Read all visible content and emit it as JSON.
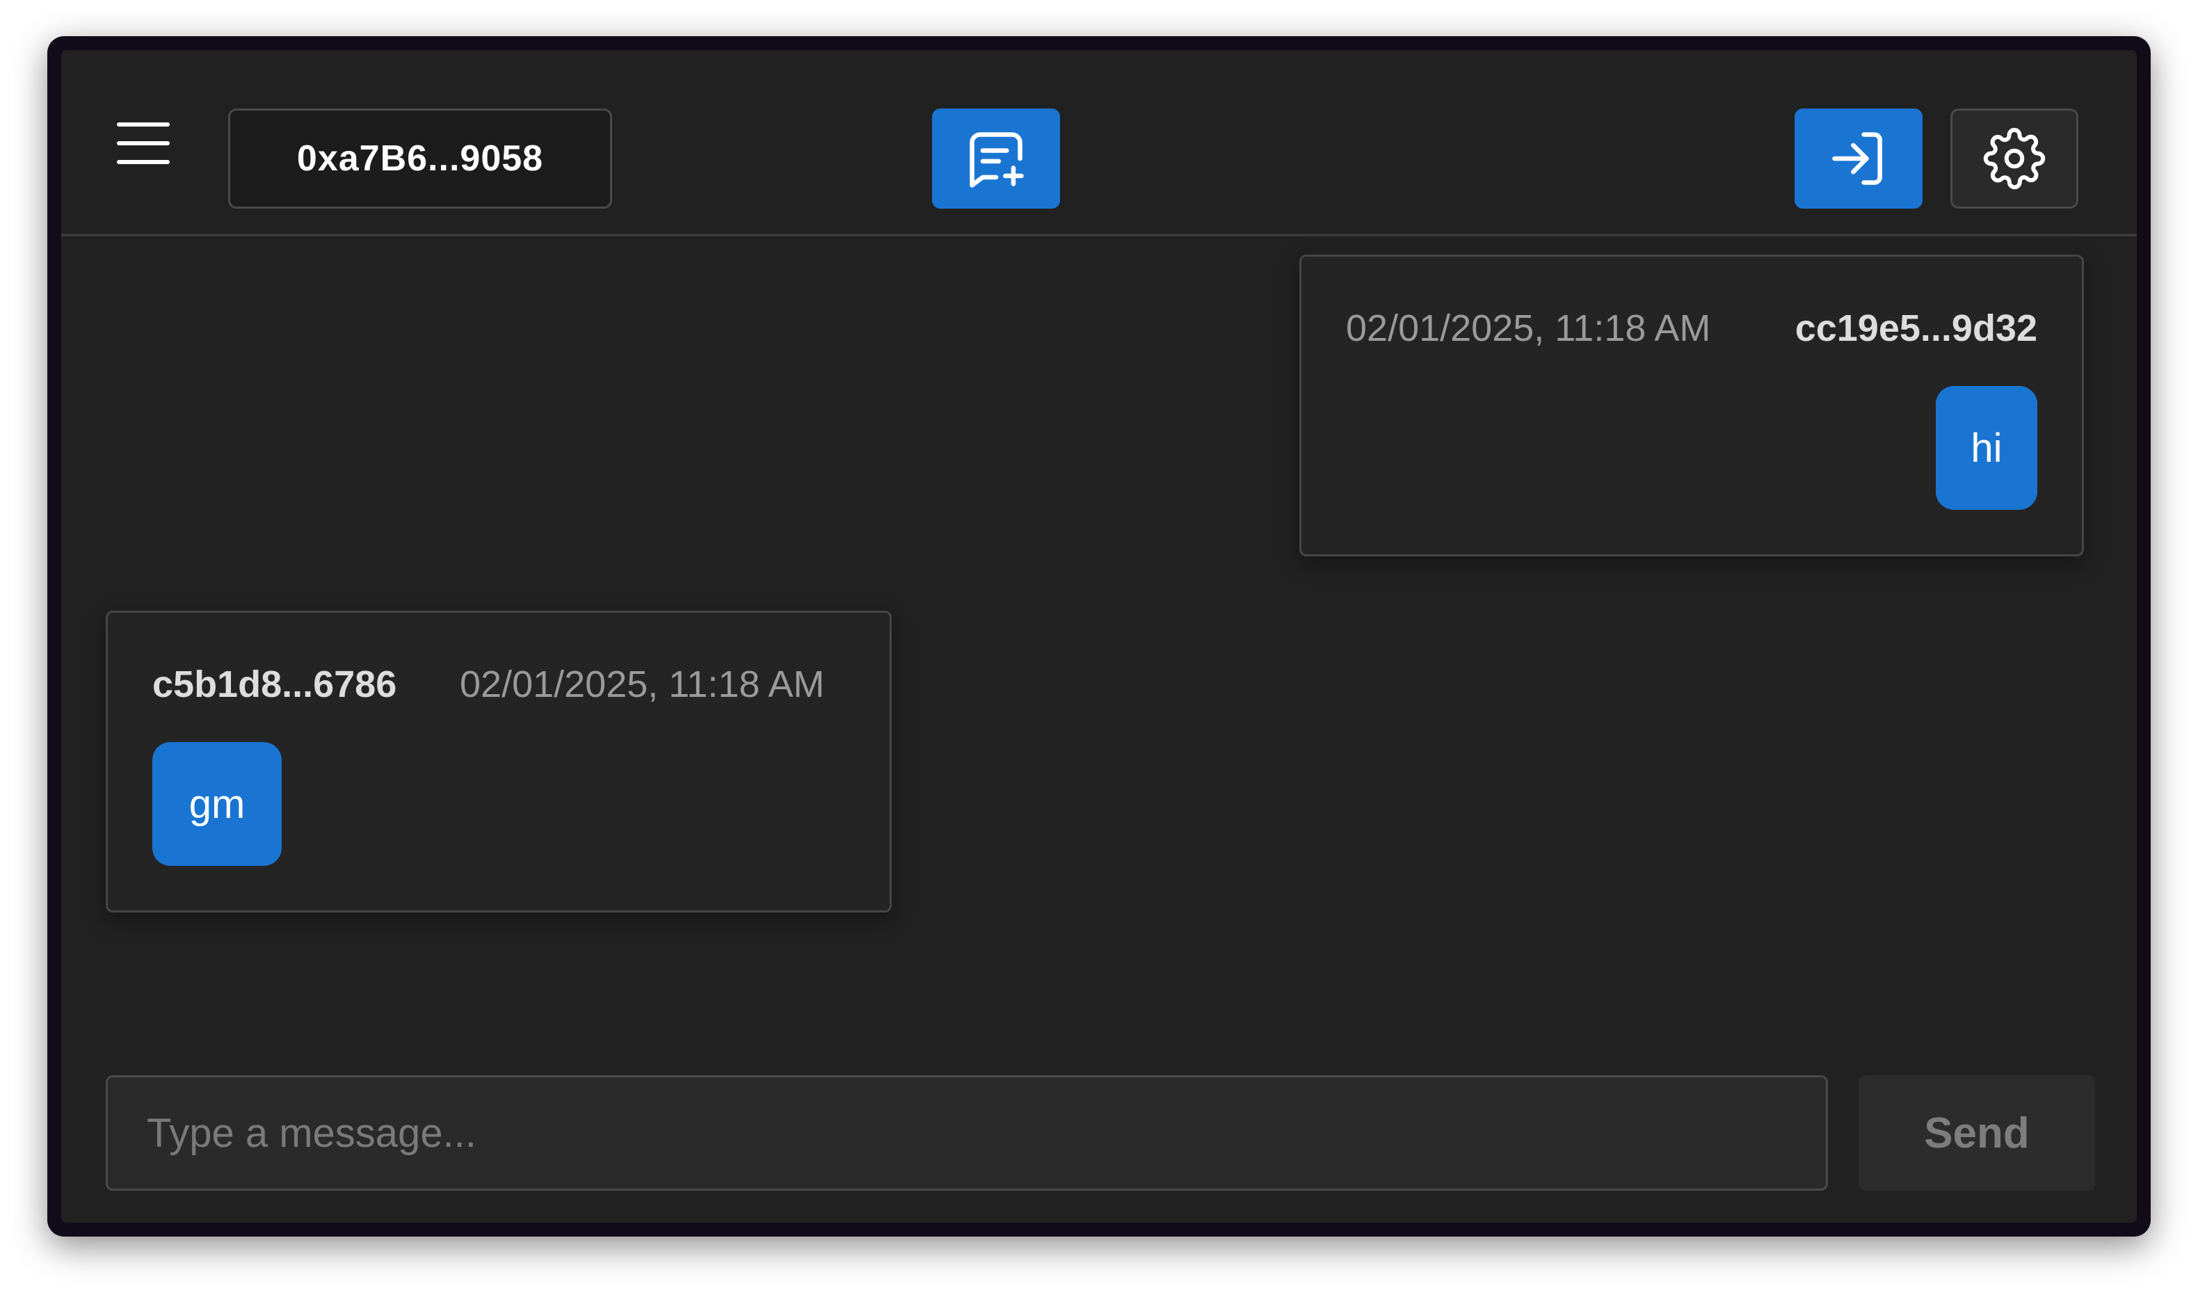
{
  "header": {
    "menu_icon": "hamburger-menu-icon",
    "wallet_address": "0xa7B6...9058",
    "new_chat_icon": "message-plus-icon",
    "login_icon": "sign-in-icon",
    "settings_icon": "gear-icon"
  },
  "messages": [
    {
      "side": "right",
      "sender": "cc19e5...9d32",
      "timestamp": "02/01/2025, 11:18 AM",
      "text": "hi"
    },
    {
      "side": "left",
      "sender": "c5b1d8...6786",
      "timestamp": "02/01/2025, 11:18 AM",
      "text": "gm"
    }
  ],
  "composer": {
    "placeholder": "Type a message...",
    "value": "",
    "send_label": "Send"
  },
  "colors": {
    "accent": "#1a75d2",
    "background": "#212121",
    "card": "#242424",
    "border": "#464646"
  }
}
